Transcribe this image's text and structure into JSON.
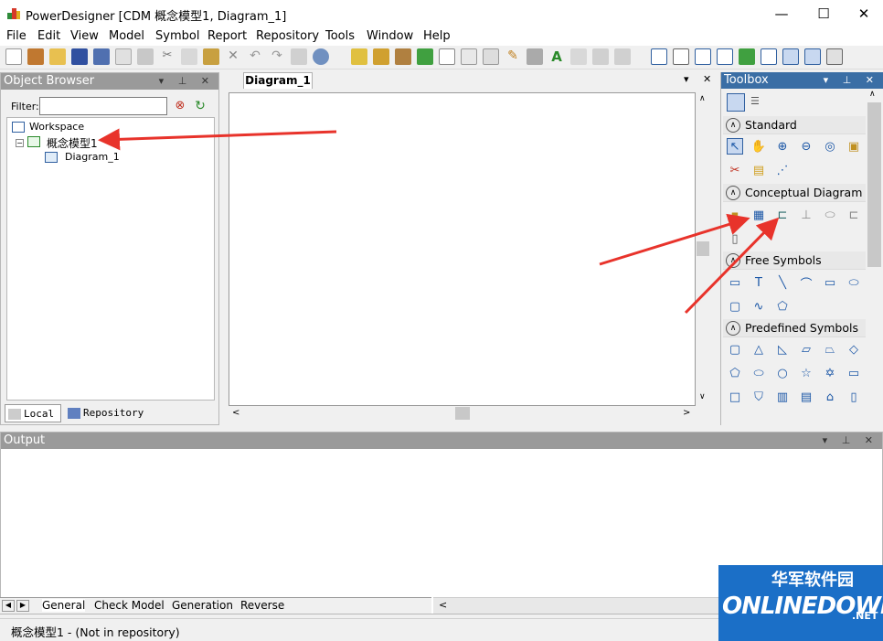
{
  "window": {
    "title": "PowerDesigner [CDM 概念模型1, Diagram_1]",
    "controls": [
      "—",
      "☐",
      "✕"
    ]
  },
  "menu": [
    "File",
    "Edit",
    "View",
    "Model",
    "Symbol",
    "Report",
    "Repository",
    "Tools",
    "Window",
    "Help"
  ],
  "object_browser": {
    "title": "Object Browser",
    "filter_label": "Filter:",
    "filter_value": "",
    "tree": {
      "workspace": "Workspace",
      "model": "概念模型1",
      "diagram": "Diagram_1"
    },
    "tabs": [
      "Local",
      "Repository"
    ]
  },
  "diagram": {
    "tab_label": "Diagram_1"
  },
  "toolbox": {
    "title": "Toolbox",
    "sections": [
      {
        "name": "Standard"
      },
      {
        "name": "Conceptual Diagram"
      },
      {
        "name": "Free Symbols"
      },
      {
        "name": "Predefined Symbols"
      }
    ]
  },
  "output": {
    "title": "Output",
    "tabs": [
      "General",
      "Check Model",
      "Generation",
      "Reverse"
    ]
  },
  "status": {
    "text": "概念模型1 - (Not in repository)"
  },
  "watermark": {
    "cn": "华军软件园",
    "en": "ONLINEDOWN",
    "suffix": ".NET"
  },
  "colors": {
    "arrow": "#e8332b",
    "toolbox_header": "#3a6ea5",
    "inactive_header": "#9a9a9a"
  }
}
